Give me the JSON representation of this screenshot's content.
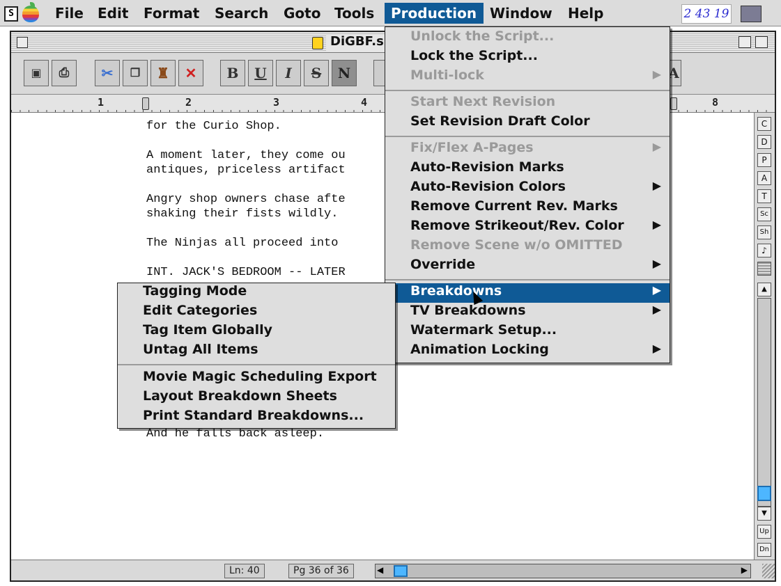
{
  "menubar": {
    "items": [
      "File",
      "Edit",
      "Format",
      "Search",
      "Goto",
      "Tools",
      "Production",
      "Window",
      "Help"
    ],
    "active": "Production",
    "clock": "2 43 19"
  },
  "window": {
    "title": "DiGBF.s"
  },
  "toolbar": {
    "bold": "B",
    "underline": "U",
    "italic": "I",
    "strike": "S",
    "normal": "N",
    "right_letter": "A"
  },
  "ruler": {
    "numbers": [
      "1",
      "2",
      "3",
      "4",
      "8"
    ]
  },
  "script": {
    "lines": [
      "for the Curio Shop.",
      "A moment later, they come ou",
      "antiques, priceless artifact",
      "Angry shop owners chase afte",
      "shaking their fists wildly.",
      "The Ninjas all proceed into",
      "INT. JACK'S BEDROOM -- LATER",
      "And he falls back asleep."
    ]
  },
  "sidebar": {
    "buttons": [
      "C",
      "D",
      "P",
      "A",
      "T",
      "Sc",
      "Sh",
      "♪"
    ],
    "up": "Up",
    "dn": "Dn"
  },
  "status": {
    "line": "Ln:  40",
    "page": "Pg 36 of 36"
  },
  "production_menu": {
    "items": [
      {
        "label": "Unlock the Script...",
        "disabled": true,
        "submenu": false
      },
      {
        "label": "Lock the Script...",
        "disabled": false,
        "submenu": false
      },
      {
        "label": "Multi-lock",
        "disabled": true,
        "submenu": true
      },
      {
        "label": "Start Next Revision",
        "disabled": true,
        "submenu": false
      },
      {
        "label": "Set Revision Draft Color",
        "disabled": false,
        "submenu": false
      },
      {
        "label": "Fix/Flex A-Pages",
        "disabled": true,
        "submenu": true
      },
      {
        "label": "Auto-Revision Marks",
        "disabled": false,
        "submenu": false
      },
      {
        "label": "Auto-Revision Colors",
        "disabled": false,
        "submenu": true
      },
      {
        "label": "Remove Current Rev. Marks",
        "disabled": false,
        "submenu": false
      },
      {
        "label": "Remove Strikeout/Rev. Color",
        "disabled": false,
        "submenu": true
      },
      {
        "label": "Remove Scene w/o OMITTED",
        "disabled": true,
        "submenu": false
      },
      {
        "label": "Override",
        "disabled": false,
        "submenu": true
      },
      {
        "label": "Breakdowns",
        "disabled": false,
        "submenu": true,
        "highlighted": true
      },
      {
        "label": "TV Breakdowns",
        "disabled": false,
        "submenu": true
      },
      {
        "label": "Watermark Setup...",
        "disabled": false,
        "submenu": false
      },
      {
        "label": "Animation Locking",
        "disabled": false,
        "submenu": true
      }
    ]
  },
  "breakdowns_submenu": {
    "items": [
      "Tagging Mode",
      "Edit Categories",
      "Tag Item Globally",
      "Untag All Items",
      "Movie Magic Scheduling Export",
      "Layout Breakdown Sheets",
      "Print Standard Breakdowns..."
    ]
  },
  "colors": {
    "highlight": "#0f5a96",
    "disabled_text": "#9a9a9a",
    "scroll_thumb": "#4db6ff"
  }
}
